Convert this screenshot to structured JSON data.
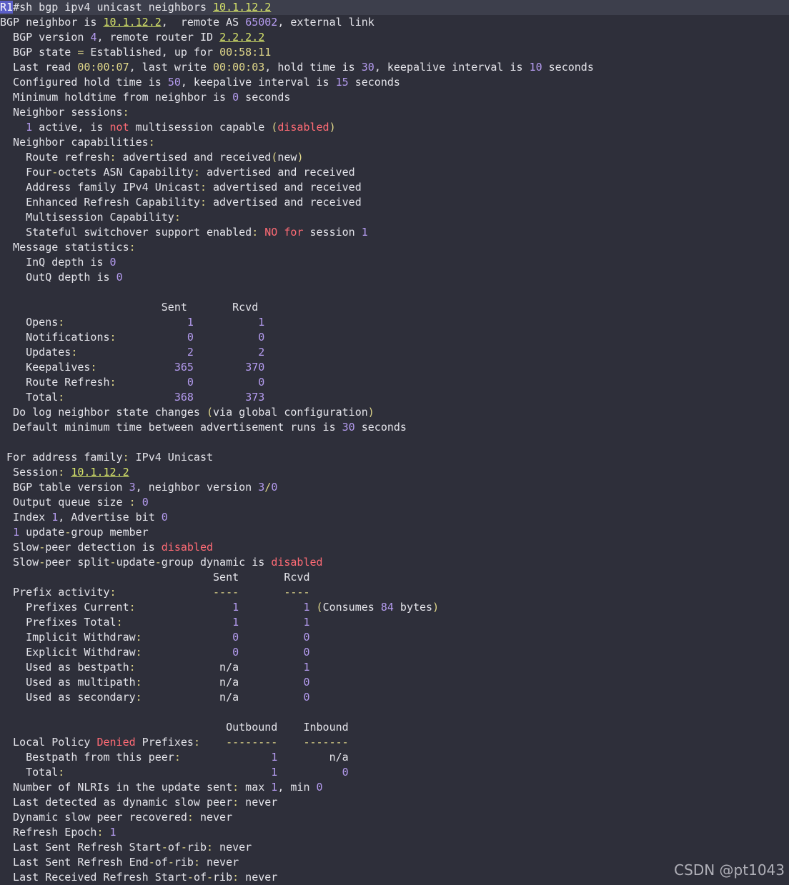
{
  "window": {
    "prompt_host": "R1",
    "command": "#sh bgp ipv4 unicast neighbors ",
    "command_arg": "10.1.12.2"
  },
  "lines": [
    [
      [
        "BGP neighbor is ",
        ""
      ],
      [
        "10.1.12.2",
        "u"
      ],
      [
        ",  remote AS ",
        ""
      ],
      [
        "65002",
        "n"
      ],
      [
        ", external link",
        ""
      ]
    ],
    [
      [
        "  BGP version ",
        ""
      ],
      [
        "4",
        "n"
      ],
      [
        ", remote router ID ",
        ""
      ],
      [
        "2.2.2.2",
        "u"
      ]
    ],
    [
      [
        "  BGP state ",
        ""
      ],
      [
        "=",
        "p"
      ],
      [
        " Established, up for ",
        ""
      ],
      [
        "00:58:11",
        "p"
      ]
    ],
    [
      [
        "  Last read ",
        ""
      ],
      [
        "00:00:07",
        "p"
      ],
      [
        ", last write ",
        ""
      ],
      [
        "00:00:03",
        "p"
      ],
      [
        ", hold time is ",
        ""
      ],
      [
        "30",
        "n"
      ],
      [
        ", keepalive interval is ",
        ""
      ],
      [
        "10",
        "n"
      ],
      [
        " seconds",
        ""
      ]
    ],
    [
      [
        "  Configured hold time is ",
        ""
      ],
      [
        "50",
        "n"
      ],
      [
        ", keepalive interval is ",
        ""
      ],
      [
        "15",
        "n"
      ],
      [
        " seconds",
        ""
      ]
    ],
    [
      [
        "  Minimum holdtime from neighbor is ",
        ""
      ],
      [
        "0",
        "n"
      ],
      [
        " seconds",
        ""
      ]
    ],
    [
      [
        "  Neighbor sessions",
        ""
      ],
      [
        ":",
        "p"
      ]
    ],
    [
      [
        "    ",
        ""
      ],
      [
        "1",
        "n"
      ],
      [
        " active, is ",
        ""
      ],
      [
        "not",
        "r"
      ],
      [
        " multisession capable ",
        ""
      ],
      [
        "(",
        "p"
      ],
      [
        "disabled",
        "r"
      ],
      [
        ")",
        "p"
      ]
    ],
    [
      [
        "  Neighbor capabilities",
        ""
      ],
      [
        ":",
        "p"
      ]
    ],
    [
      [
        "    Route refresh",
        ""
      ],
      [
        ":",
        "p"
      ],
      [
        " advertised and received",
        ""
      ],
      [
        "(",
        "p"
      ],
      [
        "new",
        ""
      ],
      [
        ")",
        "p"
      ]
    ],
    [
      [
        "    Four",
        ""
      ],
      [
        "-",
        "p"
      ],
      [
        "octets ASN Capability",
        ""
      ],
      [
        ":",
        "p"
      ],
      [
        " advertised and received",
        ""
      ]
    ],
    [
      [
        "    Address family IPv4 Unicast",
        ""
      ],
      [
        ":",
        "p"
      ],
      [
        " advertised and received",
        ""
      ]
    ],
    [
      [
        "    Enhanced Refresh Capability",
        ""
      ],
      [
        ":",
        "p"
      ],
      [
        " advertised and received",
        ""
      ]
    ],
    [
      [
        "    Multisession Capability",
        ""
      ],
      [
        ":",
        "p"
      ]
    ],
    [
      [
        "    Stateful switchover support enabled",
        ""
      ],
      [
        ":",
        "p"
      ],
      [
        " ",
        ""
      ],
      [
        "NO",
        "r"
      ],
      [
        " ",
        ""
      ],
      [
        "for",
        "r"
      ],
      [
        " session ",
        ""
      ],
      [
        "1",
        "n"
      ]
    ],
    [
      [
        "  Message statistics",
        ""
      ],
      [
        ":",
        "p"
      ]
    ],
    [
      [
        "    InQ depth is ",
        ""
      ],
      [
        "0",
        "n"
      ]
    ],
    [
      [
        "    OutQ depth is ",
        ""
      ],
      [
        "0",
        "n"
      ]
    ],
    [],
    [
      [
        "                         Sent       Rcvd",
        ""
      ]
    ],
    [
      [
        "    Opens",
        ""
      ],
      [
        ":",
        "p"
      ],
      [
        "                   ",
        ""
      ],
      [
        "1",
        "n"
      ],
      [
        "          ",
        ""
      ],
      [
        "1",
        "n"
      ]
    ],
    [
      [
        "    Notifications",
        ""
      ],
      [
        ":",
        "p"
      ],
      [
        "           ",
        ""
      ],
      [
        "0",
        "n"
      ],
      [
        "          ",
        ""
      ],
      [
        "0",
        "n"
      ]
    ],
    [
      [
        "    Updates",
        ""
      ],
      [
        ":",
        "p"
      ],
      [
        "                 ",
        ""
      ],
      [
        "2",
        "n"
      ],
      [
        "          ",
        ""
      ],
      [
        "2",
        "n"
      ]
    ],
    [
      [
        "    Keepalives",
        ""
      ],
      [
        ":",
        "p"
      ],
      [
        "            ",
        ""
      ],
      [
        "365",
        "n"
      ],
      [
        "        ",
        ""
      ],
      [
        "370",
        "n"
      ]
    ],
    [
      [
        "    Route Refresh",
        ""
      ],
      [
        ":",
        "p"
      ],
      [
        "           ",
        ""
      ],
      [
        "0",
        "n"
      ],
      [
        "          ",
        ""
      ],
      [
        "0",
        "n"
      ]
    ],
    [
      [
        "    Total",
        ""
      ],
      [
        ":",
        "p"
      ],
      [
        "                 ",
        ""
      ],
      [
        "368",
        "n"
      ],
      [
        "        ",
        ""
      ],
      [
        "373",
        "n"
      ]
    ],
    [
      [
        "  Do log neighbor state changes ",
        ""
      ],
      [
        "(",
        "p"
      ],
      [
        "via global configuration",
        ""
      ],
      [
        ")",
        "p"
      ]
    ],
    [
      [
        "  Default minimum time between advertisement runs is ",
        ""
      ],
      [
        "30",
        "n"
      ],
      [
        " seconds",
        ""
      ]
    ],
    [],
    [
      [
        " For address family",
        ""
      ],
      [
        ":",
        "p"
      ],
      [
        " IPv4 Unicast",
        ""
      ]
    ],
    [
      [
        "  Session",
        ""
      ],
      [
        ":",
        "p"
      ],
      [
        " ",
        ""
      ],
      [
        "10.1.12.2",
        "u"
      ]
    ],
    [
      [
        "  BGP table version ",
        ""
      ],
      [
        "3",
        "n"
      ],
      [
        ", neighbor version ",
        ""
      ],
      [
        "3",
        "n"
      ],
      [
        "/",
        "p"
      ],
      [
        "0",
        "n"
      ]
    ],
    [
      [
        "  Output queue size ",
        ""
      ],
      [
        ":",
        "p"
      ],
      [
        " ",
        ""
      ],
      [
        "0",
        "n"
      ]
    ],
    [
      [
        "  Index ",
        ""
      ],
      [
        "1",
        "n"
      ],
      [
        ", Advertise bit ",
        ""
      ],
      [
        "0",
        "n"
      ]
    ],
    [
      [
        "  ",
        ""
      ],
      [
        "1",
        "n"
      ],
      [
        " update",
        ""
      ],
      [
        "-",
        "p"
      ],
      [
        "group member",
        ""
      ]
    ],
    [
      [
        "  Slow",
        ""
      ],
      [
        "-",
        "p"
      ],
      [
        "peer detection is ",
        ""
      ],
      [
        "disabled",
        "r"
      ]
    ],
    [
      [
        "  Slow",
        ""
      ],
      [
        "-",
        "p"
      ],
      [
        "peer split",
        ""
      ],
      [
        "-",
        "p"
      ],
      [
        "update",
        ""
      ],
      [
        "-",
        "p"
      ],
      [
        "group dynamic is ",
        ""
      ],
      [
        "disabled",
        "r"
      ]
    ],
    [
      [
        "                                 Sent       Rcvd",
        ""
      ]
    ],
    [
      [
        "  Prefix activity",
        ""
      ],
      [
        ":",
        "p"
      ],
      [
        "               ",
        ""
      ],
      [
        "----       ----",
        "p"
      ]
    ],
    [
      [
        "    Prefixes Current",
        ""
      ],
      [
        ":",
        "p"
      ],
      [
        "               ",
        ""
      ],
      [
        "1",
        "n"
      ],
      [
        "          ",
        ""
      ],
      [
        "1",
        "n"
      ],
      [
        " ",
        ""
      ],
      [
        "(",
        "p"
      ],
      [
        "Consumes ",
        ""
      ],
      [
        "84",
        "n"
      ],
      [
        " bytes",
        ""
      ],
      [
        ")",
        "p"
      ]
    ],
    [
      [
        "    Prefixes Total",
        ""
      ],
      [
        ":",
        "p"
      ],
      [
        "                 ",
        ""
      ],
      [
        "1",
        "n"
      ],
      [
        "          ",
        ""
      ],
      [
        "1",
        "n"
      ]
    ],
    [
      [
        "    Implicit Withdraw",
        ""
      ],
      [
        ":",
        "p"
      ],
      [
        "              ",
        ""
      ],
      [
        "0",
        "n"
      ],
      [
        "          ",
        ""
      ],
      [
        "0",
        "n"
      ]
    ],
    [
      [
        "    Explicit Withdraw",
        ""
      ],
      [
        ":",
        "p"
      ],
      [
        "              ",
        ""
      ],
      [
        "0",
        "n"
      ],
      [
        "          ",
        ""
      ],
      [
        "0",
        "n"
      ]
    ],
    [
      [
        "    Used as bestpath",
        ""
      ],
      [
        ":",
        "p"
      ],
      [
        "             n/a          ",
        ""
      ],
      [
        "1",
        "n"
      ]
    ],
    [
      [
        "    Used as multipath",
        ""
      ],
      [
        ":",
        "p"
      ],
      [
        "            n/a          ",
        ""
      ],
      [
        "0",
        "n"
      ]
    ],
    [
      [
        "    Used as secondary",
        ""
      ],
      [
        ":",
        "p"
      ],
      [
        "            n/a          ",
        ""
      ],
      [
        "0",
        "n"
      ]
    ],
    [],
    [
      [
        "                                   Outbound    Inbound",
        ""
      ]
    ],
    [
      [
        "  Local Policy ",
        ""
      ],
      [
        "Denied",
        "r"
      ],
      [
        " Prefixes",
        ""
      ],
      [
        ":",
        "p"
      ],
      [
        "    ",
        ""
      ],
      [
        "--------    -------",
        "p"
      ]
    ],
    [
      [
        "    Bestpath from this peer",
        ""
      ],
      [
        ":",
        "p"
      ],
      [
        "              ",
        ""
      ],
      [
        "1",
        "n"
      ],
      [
        "        n/a",
        ""
      ]
    ],
    [
      [
        "    Total",
        ""
      ],
      [
        ":",
        "p"
      ],
      [
        "                                ",
        ""
      ],
      [
        "1",
        "n"
      ],
      [
        "          ",
        ""
      ],
      [
        "0",
        "n"
      ]
    ],
    [
      [
        "  Number of NLRIs in the update sent",
        ""
      ],
      [
        ":",
        "p"
      ],
      [
        " max ",
        ""
      ],
      [
        "1",
        "n"
      ],
      [
        ", min ",
        ""
      ],
      [
        "0",
        "n"
      ]
    ],
    [
      [
        "  Last detected as dynamic slow peer",
        ""
      ],
      [
        ":",
        "p"
      ],
      [
        " never",
        ""
      ]
    ],
    [
      [
        "  Dynamic slow peer recovered",
        ""
      ],
      [
        ":",
        "p"
      ],
      [
        " never",
        ""
      ]
    ],
    [
      [
        "  Refresh Epoch",
        ""
      ],
      [
        ":",
        "p"
      ],
      [
        " ",
        ""
      ],
      [
        "1",
        "n"
      ]
    ],
    [
      [
        "  Last Sent Refresh Start",
        ""
      ],
      [
        "-",
        "p"
      ],
      [
        "of",
        ""
      ],
      [
        "-",
        "p"
      ],
      [
        "rib",
        ""
      ],
      [
        ":",
        "p"
      ],
      [
        " never",
        ""
      ]
    ],
    [
      [
        "  Last Sent Refresh End",
        ""
      ],
      [
        "-",
        "p"
      ],
      [
        "of",
        ""
      ],
      [
        "-",
        "p"
      ],
      [
        "rib",
        ""
      ],
      [
        ":",
        "p"
      ],
      [
        " never",
        ""
      ]
    ],
    [
      [
        "  Last Received Refresh Start",
        ""
      ],
      [
        "-",
        "p"
      ],
      [
        "of",
        ""
      ],
      [
        "-",
        "p"
      ],
      [
        "rib",
        ""
      ],
      [
        ":",
        "p"
      ],
      [
        " never",
        ""
      ]
    ]
  ],
  "watermark": "CSDN @pt1043",
  "colors": {
    "background": "#2e2f3a",
    "text": "#e4e4ea",
    "number": "#b59cf0",
    "punct": "#e0d78a",
    "alert": "#ff6b75",
    "address": "#d7e46a"
  }
}
